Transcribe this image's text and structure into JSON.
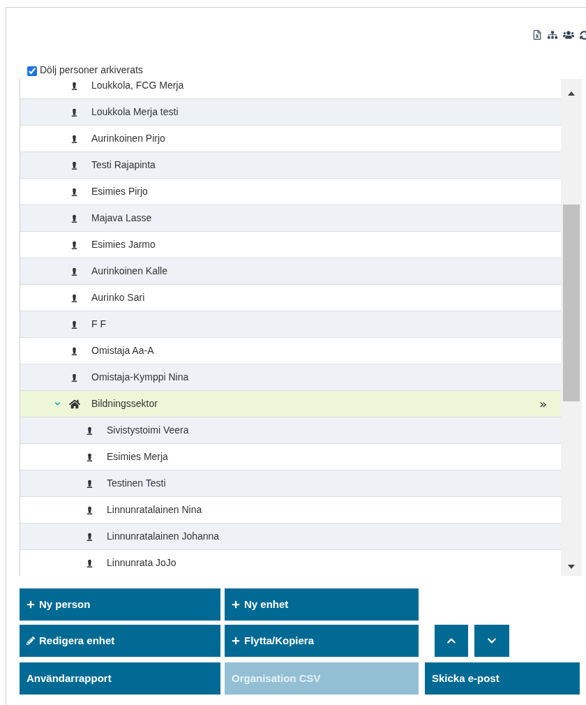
{
  "hide_archived": {
    "label": "Dölj personer arkiverats",
    "checked": true
  },
  "tree": {
    "items": [
      {
        "name": "Loukkola, FCG Merja",
        "selected": false
      },
      {
        "name": "Loukkola Merja testi",
        "selected": false
      },
      {
        "name": "Aurinkoinen Pirjo",
        "selected": false
      },
      {
        "name": "Testi Rajapinta",
        "selected": false
      },
      {
        "name": "Esimies Pirjo",
        "selected": false
      },
      {
        "name": "Majava Lasse",
        "selected": false
      },
      {
        "name": "Esimies Jarmo",
        "selected": false
      },
      {
        "name": "Aurinkoinen Kalle",
        "selected": false
      },
      {
        "name": "Aurinko Sari",
        "selected": false
      },
      {
        "name": "F F",
        "selected": false
      },
      {
        "name": "Omistaja Aa-A",
        "selected": false
      },
      {
        "name": "Omistaja-Kymppi Nina",
        "selected": false
      },
      {
        "name": "Bildningssektor",
        "selected": true,
        "expanded": true,
        "action": "»",
        "children": [
          {
            "name": "Sivistystoimi Veera",
            "selected": false
          },
          {
            "name": "Esimies Merja",
            "selected": false
          },
          {
            "name": "Testinen Testi",
            "selected": false
          },
          {
            "name": "Linnunratalainen Nina",
            "selected": false
          },
          {
            "name": "Linnunratalainen Johanna",
            "selected": false
          },
          {
            "name": "Linnunrata JoJo",
            "selected": false
          }
        ]
      }
    ]
  },
  "buttons": [
    {
      "label": "Ny person",
      "disabled": false
    },
    {
      "label": "Ny enhet",
      "disabled": false
    },
    {
      "label": "Redigera enhet",
      "disabled": false
    },
    {
      "label": "Flytta/Kopiera",
      "disabled": false
    },
    {
      "label": "Användarrapport",
      "disabled": false
    },
    {
      "label": "Organisation CSV",
      "disabled": true
    },
    {
      "label": "Skicka e-post",
      "disabled": false
    }
  ]
}
